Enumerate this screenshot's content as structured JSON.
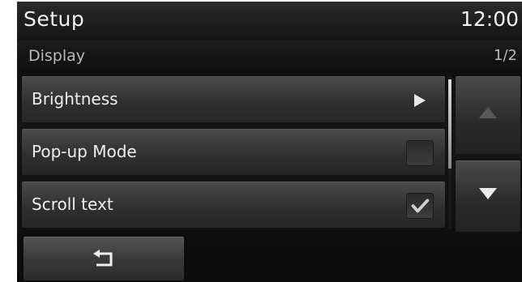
{
  "header": {
    "title": "Setup",
    "clock": "12:00"
  },
  "subheader": {
    "title": "Display",
    "page": "1/2"
  },
  "menu": {
    "items": [
      {
        "label": "Brightness",
        "control": "arrow-right-icon"
      },
      {
        "label": "Pop-up Mode",
        "control": "checkbox",
        "checked": false
      },
      {
        "label": "Scroll text",
        "control": "checkbox",
        "checked": true
      }
    ]
  },
  "nav": {
    "up_icon": "arrow-up-icon",
    "down_icon": "arrow-down-icon",
    "back_icon": "back-arrow-icon"
  },
  "colors": {
    "accent_text": "#f2f2f2",
    "muted_text": "#b8b8b8",
    "inactive_icon": "#5a5a5a"
  }
}
